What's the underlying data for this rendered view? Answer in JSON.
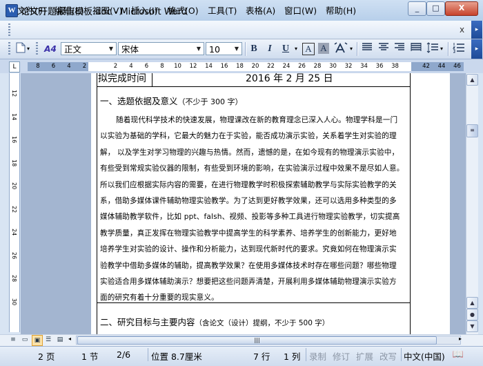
{
  "window": {
    "title": "论文开题报告模板.doc - Microsoft Word",
    "app_icon": "W",
    "minimize": "_",
    "maximize": "□",
    "close": "X"
  },
  "menu": {
    "items": [
      "文件(F)",
      "编辑(E)",
      "视图(V)",
      "插入(I)",
      "格式(O)",
      "工具(T)",
      "表格(A)",
      "窗口(W)",
      "帮助(H)"
    ],
    "doc_close": "x"
  },
  "toolbar": {
    "style": "正文",
    "font": "宋体",
    "size": "10",
    "bold": "B",
    "italic": "I",
    "underline": "U",
    "border_char": "A",
    "shade_char": "A",
    "style_icon_text": "A4"
  },
  "ruler": {
    "horizontal_ticks": [
      "8",
      "6",
      "4",
      "2",
      "",
      "2",
      "4",
      "6",
      "8",
      "10",
      "12",
      "14",
      "16",
      "18",
      "20",
      "22",
      "24",
      "26",
      "28",
      "30",
      "32",
      "34",
      "36",
      "38",
      "",
      "42",
      "44",
      "46"
    ],
    "vertical_ticks": [
      "12",
      "14",
      "16",
      "18",
      "20",
      "22",
      "24",
      "26",
      "28",
      "30"
    ]
  },
  "document": {
    "cell_label": "拟完成时间",
    "cell_date": "2016 年 2 月 25 日",
    "section1_heading": "一、选题依据及意义",
    "section1_note": "（不少于 300 字）",
    "paragraph_lines": [
      "随着现代科学技术的快速发展，物理课改在新的教育理念已深入人心。物理学科是一门",
      "以实验为基础的学科，它最大的魅力在于实验，能否成功演示实验，关系着学生对实验的理",
      "解，  以及学生对学习物理的兴趣与热情。然而，遗憾的是，在如今现有的物理演示实验中，",
      "有些受到常规实验仪器的限制，有些受到环境的影响，在实验演示过程中效果不是尽如人意。",
      "所以我们应根据实际内容的需要，在进行物理教学时积极探索辅助教学与实际实验教学的关",
      "系，借助多媒体课件辅助物理实验教学。为了达到更好教学效果，还可以选用多种类型的多",
      "媒体辅助教学软件，比如 ppt、falsh、视频、投影等多种工具进行物理实验教学，切实提高",
      "教学质量，真正发挥在物理实验教学中提高学生的科学素养、培养学生的创新能力，更好地",
      "培养学生对实验的设计、操作和分析能力，达到现代新时代的要求。究竟如何在物理演示实",
      "验教学中借助多媒体的辅助，提高教学效果？在使用多媒体技术时存在哪些问题？哪些物理",
      "实验适合用多媒体辅助演示？想要把这些问题弄清楚，开展利用多媒体辅助物理演示实验方",
      "面的研究有着十分重要的现实意义。"
    ],
    "section2_heading": "二、研究目标与主要内容",
    "section2_note": "（含论文（设计）提纲，不少于 500 字）"
  },
  "status": {
    "page": "2 页",
    "section": "1 节",
    "page_of": "2/6",
    "position": "位置 8.7厘米",
    "line": "7 行",
    "column": "1 列",
    "rec": "录制",
    "trk": "修订",
    "ext": "扩展",
    "ovr": "改写",
    "language": "中文(中国)"
  }
}
